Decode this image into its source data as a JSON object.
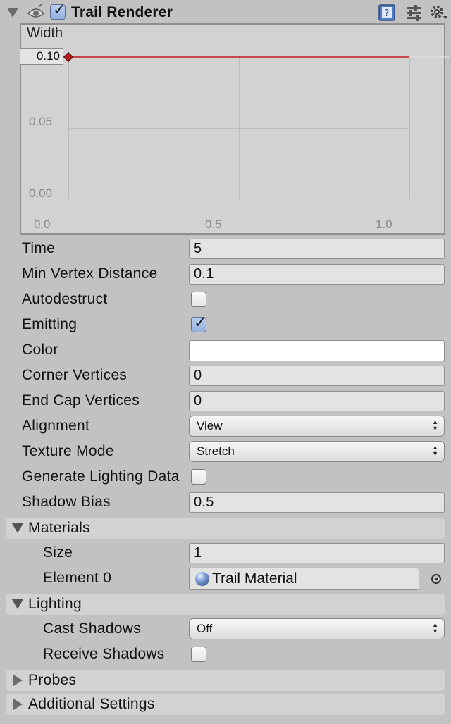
{
  "component": {
    "title": "Trail Renderer",
    "enabled": true,
    "header_icons": [
      "eye-icon",
      "help-book-icon",
      "preset-sliders-icon",
      "gear-icon"
    ]
  },
  "width_curve": {
    "label": "Width",
    "current_value": "0.10",
    "y_ticks": [
      "0.05",
      "0.00"
    ],
    "x_ticks": [
      "0.0",
      "0.5",
      "1.0"
    ],
    "line_color": "#c01818",
    "key_color": "#c01818"
  },
  "chart_data": {
    "type": "line",
    "title": "",
    "xlabel": "",
    "ylabel": "Width",
    "x": [
      0.0,
      1.0
    ],
    "series": [
      {
        "values": [
          0.1,
          0.1
        ]
      }
    ],
    "xlim": [
      0.0,
      1.0
    ],
    "ylim": [
      0.0,
      0.1
    ],
    "x_ticks": [
      "0.0",
      "0.5",
      "1.0"
    ],
    "y_ticks": [
      "0.00",
      "0.05",
      "0.10"
    ],
    "grid": true
  },
  "properties": {
    "time": {
      "label": "Time",
      "value": "5"
    },
    "min_vertex_distance": {
      "label": "Min Vertex Distance",
      "value": "0.1"
    },
    "autodestruct": {
      "label": "Autodestruct",
      "checked": false
    },
    "emitting": {
      "label": "Emitting",
      "checked": true
    },
    "color": {
      "label": "Color",
      "value_color": "#ffffff"
    },
    "corner_vertices": {
      "label": "Corner Vertices",
      "value": "0"
    },
    "end_cap_vertices": {
      "label": "End Cap Vertices",
      "value": "0"
    },
    "alignment": {
      "label": "Alignment",
      "selected": "View"
    },
    "texture_mode": {
      "label": "Texture Mode",
      "selected": "Stretch"
    },
    "generate_lighting_data": {
      "label": "Generate Lighting Data",
      "checked": false
    },
    "shadow_bias": {
      "label": "Shadow Bias",
      "value": "0.5"
    }
  },
  "materials": {
    "title": "Materials",
    "expanded": true,
    "size": {
      "label": "Size",
      "value": "1"
    },
    "element0": {
      "label": "Element 0",
      "value": "Trail Material"
    }
  },
  "lighting": {
    "title": "Lighting",
    "expanded": true,
    "cast_shadows": {
      "label": "Cast Shadows",
      "selected": "Off"
    },
    "receive_shadows": {
      "label": "Receive Shadows",
      "checked": false
    }
  },
  "probes": {
    "title": "Probes",
    "expanded": false
  },
  "additional_settings": {
    "title": "Additional Settings",
    "expanded": false
  }
}
